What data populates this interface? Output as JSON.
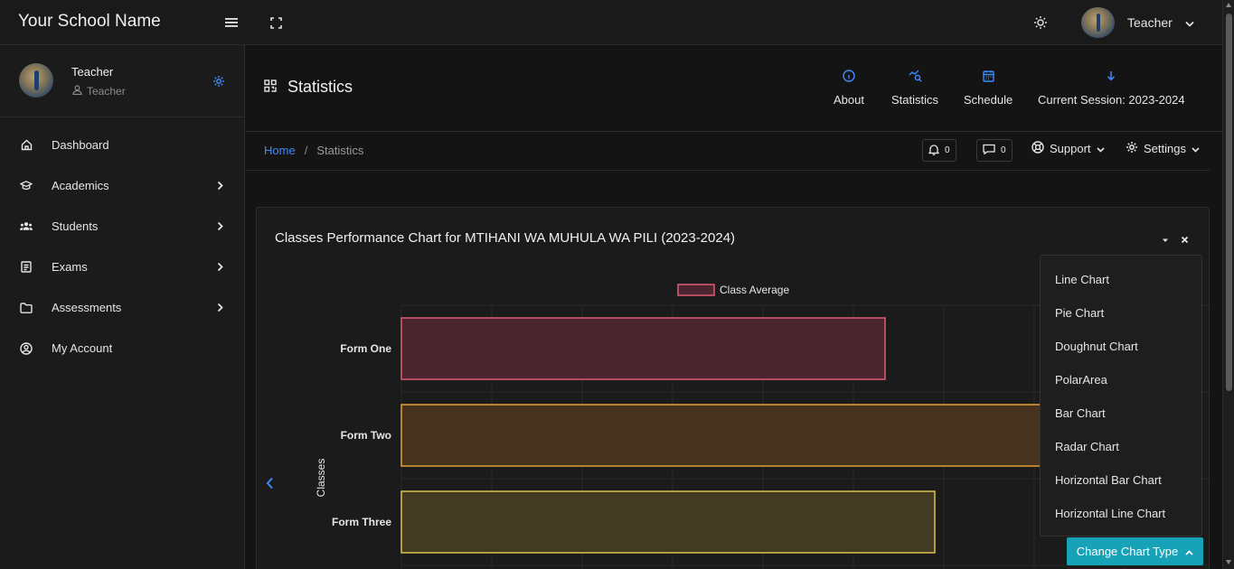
{
  "app": {
    "brand": "Your School Name",
    "user_name": "Teacher",
    "icons": [
      "menu-icon",
      "fullscreen-icon",
      "theme-sun-icon",
      "chevron-down-icon"
    ]
  },
  "sidebar": {
    "profile_name": "Teacher",
    "profile_role": "Teacher",
    "items": [
      {
        "label": "Dashboard",
        "icon": "home-icon",
        "has_submenu": false
      },
      {
        "label": "Academics",
        "icon": "graduation-cap-icon",
        "has_submenu": true
      },
      {
        "label": "Students",
        "icon": "users-icon",
        "has_submenu": true
      },
      {
        "label": "Exams",
        "icon": "exam-list-icon",
        "has_submenu": true
      },
      {
        "label": "Assessments",
        "icon": "folder-icon",
        "has_submenu": true
      },
      {
        "label": "My Account",
        "icon": "user-circle-icon",
        "has_submenu": false
      }
    ]
  },
  "header": {
    "title": "Statistics",
    "links": {
      "about": "About",
      "statistics": "Statistics",
      "schedule": "Schedule",
      "session": "Current Session: 2023-2024"
    }
  },
  "breadcrumb": {
    "home": "Home",
    "separator": "/",
    "current": "Statistics",
    "notifications_count": "0",
    "messages_count": "0",
    "support_label": "Support",
    "settings_label": "Settings"
  },
  "card": {
    "title": "Classes Performance Chart for MTIHANI WA MUHULA WA PILI (2023-2024)"
  },
  "chart_data": {
    "type": "bar",
    "orientation": "horizontal",
    "ylabel": "Classes",
    "categories": [
      "Form One",
      "Form Two",
      "Form Three"
    ],
    "series": [
      {
        "name": "Class Average",
        "values": [
          53.5,
          72,
          59
        ]
      }
    ],
    "xlim": [
      0,
      100
    ],
    "grid": true,
    "legend": "top",
    "colors": {
      "Form One": {
        "fill": "#4a2530",
        "stroke": "#e05c75"
      },
      "Form Two": {
        "fill": "#47311f",
        "stroke": "#e3a133"
      },
      "Form Three": {
        "fill": "#423a23",
        "stroke": "#dcc14a"
      }
    }
  },
  "chart_type_menu": {
    "options": [
      "Line Chart",
      "Pie Chart",
      "Doughnut Chart",
      "PolarArea",
      "Bar Chart",
      "Radar Chart",
      "Horizontal Bar Chart",
      "Horizontal Line Chart"
    ],
    "button_label": "Change Chart Type"
  },
  "theme": {
    "accent": "#3d8bfd",
    "button": "#17a2b8",
    "background": "#141414"
  }
}
